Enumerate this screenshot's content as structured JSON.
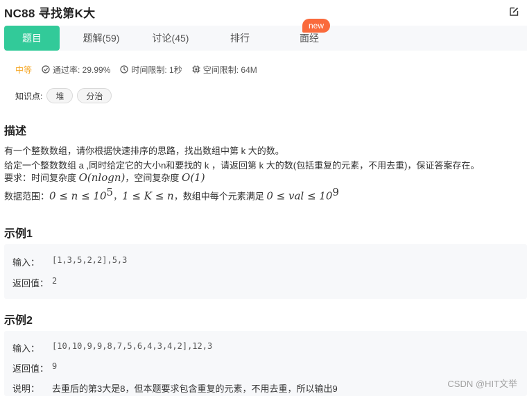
{
  "problem": {
    "title": "NC88  寻找第K大"
  },
  "tabs": [
    {
      "label": "题目",
      "active": true
    },
    {
      "label": "题解(59)",
      "active": false
    },
    {
      "label": "讨论(45)",
      "active": false
    },
    {
      "label": "排行",
      "active": false
    },
    {
      "label": "面经",
      "active": false
    }
  ],
  "new_badge": "new",
  "meta": {
    "difficulty": "中等",
    "pass_rate": "通过率: 29.99%",
    "time_limit": "时间限制: 1秒",
    "space_limit": "空间限制: 64M"
  },
  "knowledge": {
    "label": "知识点:",
    "tags": [
      "堆",
      "分治"
    ]
  },
  "description": {
    "heading": "描述",
    "line1": "有一个整数数组，请你根据快速排序的思路，找出数组中第 k 大的数。",
    "line2": "给定一个整数数组 a ,同时给定它的大小n和要找的 k ，请返回第 k 大的数(包括重复的元素，不用去重)，保证答案存在。",
    "req_prefix": "要求：时间复杂度 ",
    "req_time": "O(nlogn)",
    "req_mid": "，空间复杂度 ",
    "req_space": "O(1)",
    "range_prefix": "数据范围：",
    "range_n": "0 ≤ n ≤ 10",
    "range_n_exp": "5",
    "range_sep": "，",
    "range_k": "1 ≤ K ≤ n",
    "range_mid": "，数组中每个元素满足 ",
    "range_val": "0 ≤ val ≤ 10",
    "range_val_exp": "9"
  },
  "example1": {
    "heading": "示例1",
    "input_label": "输入：",
    "input_value": "[1,3,5,2,2],5,3",
    "output_label": "返回值：",
    "output_value": "2"
  },
  "example2": {
    "heading": "示例2",
    "input_label": "输入：",
    "input_value": "[10,10,9,9,8,7,5,6,4,3,4,2],12,3",
    "output_label": "返回值：",
    "output_value": "9",
    "note_label": "说明：",
    "note_value": "去重后的第3大是8，但本题要求包含重复的元素，不用去重，所以输出9"
  },
  "watermark": "CSDN @HIT文举",
  "colors": {
    "accent": "#32ca99",
    "badge": "#fa6a3c",
    "difficulty": "#f5a623"
  }
}
